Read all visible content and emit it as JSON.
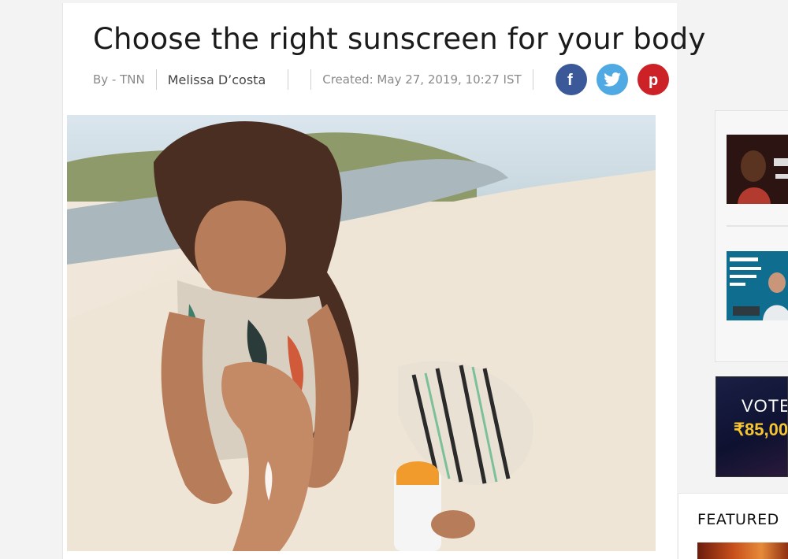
{
  "article": {
    "title": "Choose the right sunscreen for your body",
    "byline_prefix": "By - TNN",
    "author": "Melissa D’costa",
    "created": "Created: May 27, 2019, 10:27 IST"
  },
  "share": [
    {
      "network": "facebook",
      "icon": "facebook-icon",
      "color": "#3b5998"
    },
    {
      "network": "twitter",
      "icon": "twitter-icon",
      "color": "#4fa9e3"
    },
    {
      "network": "pinterest",
      "icon": "pinterest-icon",
      "color": "#cc2127"
    }
  ],
  "hero_image": {
    "subject": "woman applying sunscreen on beach"
  },
  "sidebar": {
    "vote_banner": {
      "line1": "VOTE",
      "line2": "₹85,00"
    },
    "featured_label": "FEATURED"
  }
}
